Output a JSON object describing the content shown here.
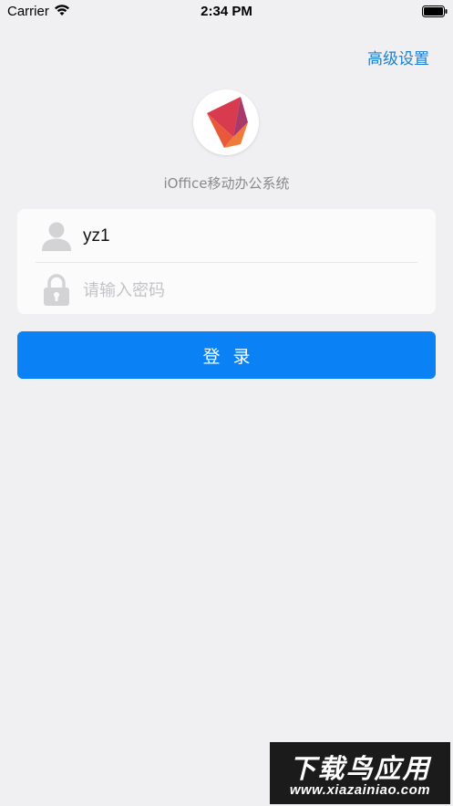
{
  "status_bar": {
    "carrier": "Carrier",
    "time": "2:34 PM",
    "icons": [
      "wifi-icon",
      "battery-icon"
    ]
  },
  "header": {
    "advanced_settings": "高级设置"
  },
  "app": {
    "logo_icon": "app-logo",
    "name": "iOffice移动办公系统"
  },
  "login_form": {
    "username": {
      "icon": "user-icon",
      "value": "yz1"
    },
    "password": {
      "icon": "lock-icon",
      "placeholder": "请输入密码",
      "value": ""
    },
    "submit_label": "登录"
  },
  "watermark": {
    "title": "下载鸟应用",
    "url": "www.xiazainiao.com"
  },
  "colors": {
    "background": "#f0f0f2",
    "accent": "#0a82f5",
    "link": "#1a7fd4",
    "placeholder": "#c3c3c7"
  }
}
